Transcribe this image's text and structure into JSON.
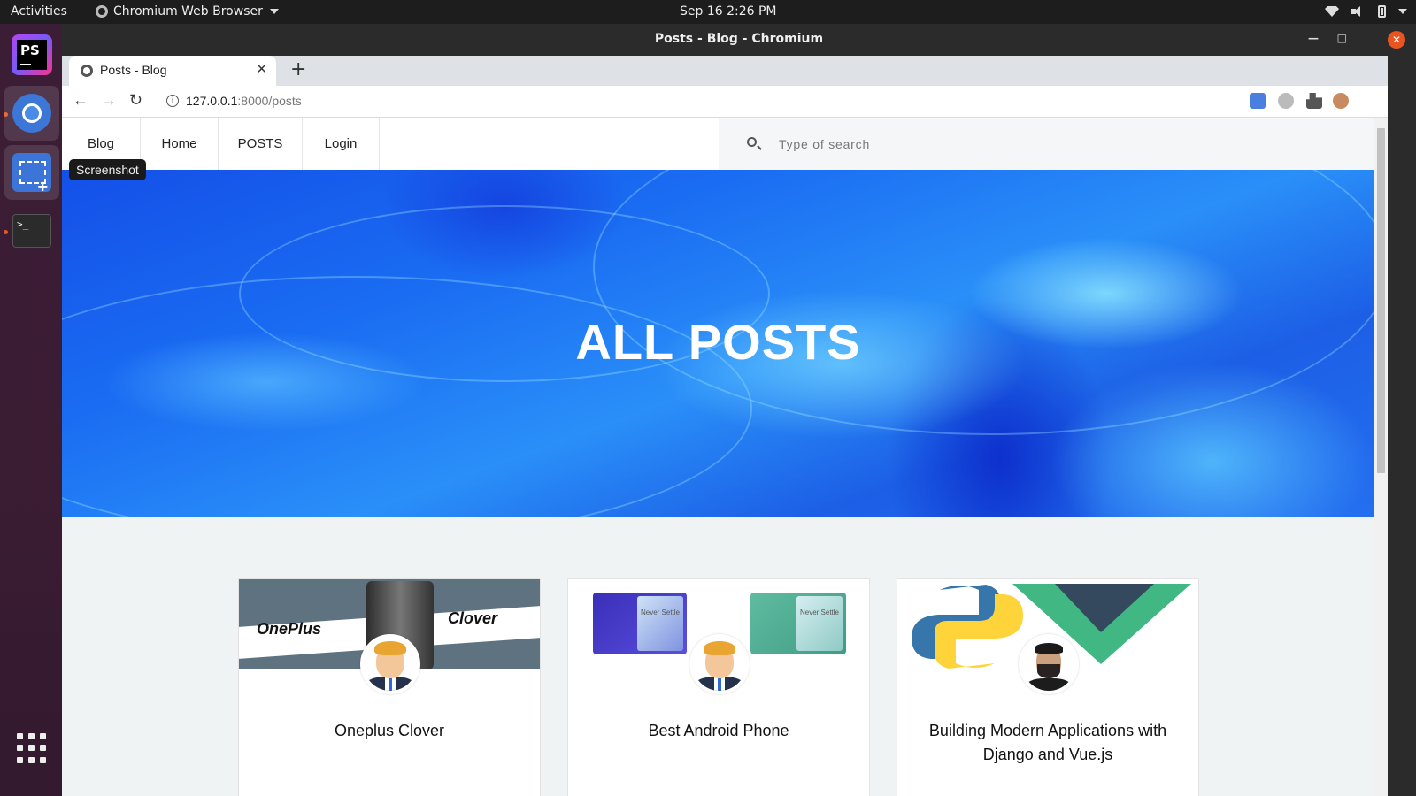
{
  "topbar": {
    "activities": "Activities",
    "app_menu": "Chromium Web Browser",
    "clock": "Sep 16  2:26 PM"
  },
  "dock": {
    "tooltip": "Screenshot",
    "terminal_prompt": ">_"
  },
  "window": {
    "title": "Posts - Blog - Chromium"
  },
  "browser": {
    "tab_title": "Posts - Blog",
    "url_host": "127.0.0.1",
    "url_path": ":8000/posts"
  },
  "site": {
    "nav": [
      "Blog",
      "Home",
      "POSTS",
      "Login"
    ],
    "search_placeholder": "Type of search",
    "hero_title": "ALL POSTS"
  },
  "posts": [
    {
      "title": "Oneplus Clover",
      "banner_left": "OnePlus",
      "banner_right": "Clover"
    },
    {
      "title": "Best Android Phone",
      "screen_text": "Never Settle"
    },
    {
      "title": "Building Modern Applications with Django and Vue.js"
    }
  ],
  "colors": {
    "accent_orange": "#e95420",
    "hero_blue": "#1a6cf2",
    "vue_green": "#41b883",
    "vue_dark": "#34495e",
    "python_blue": "#3776ab",
    "python_yellow": "#ffd43b"
  }
}
